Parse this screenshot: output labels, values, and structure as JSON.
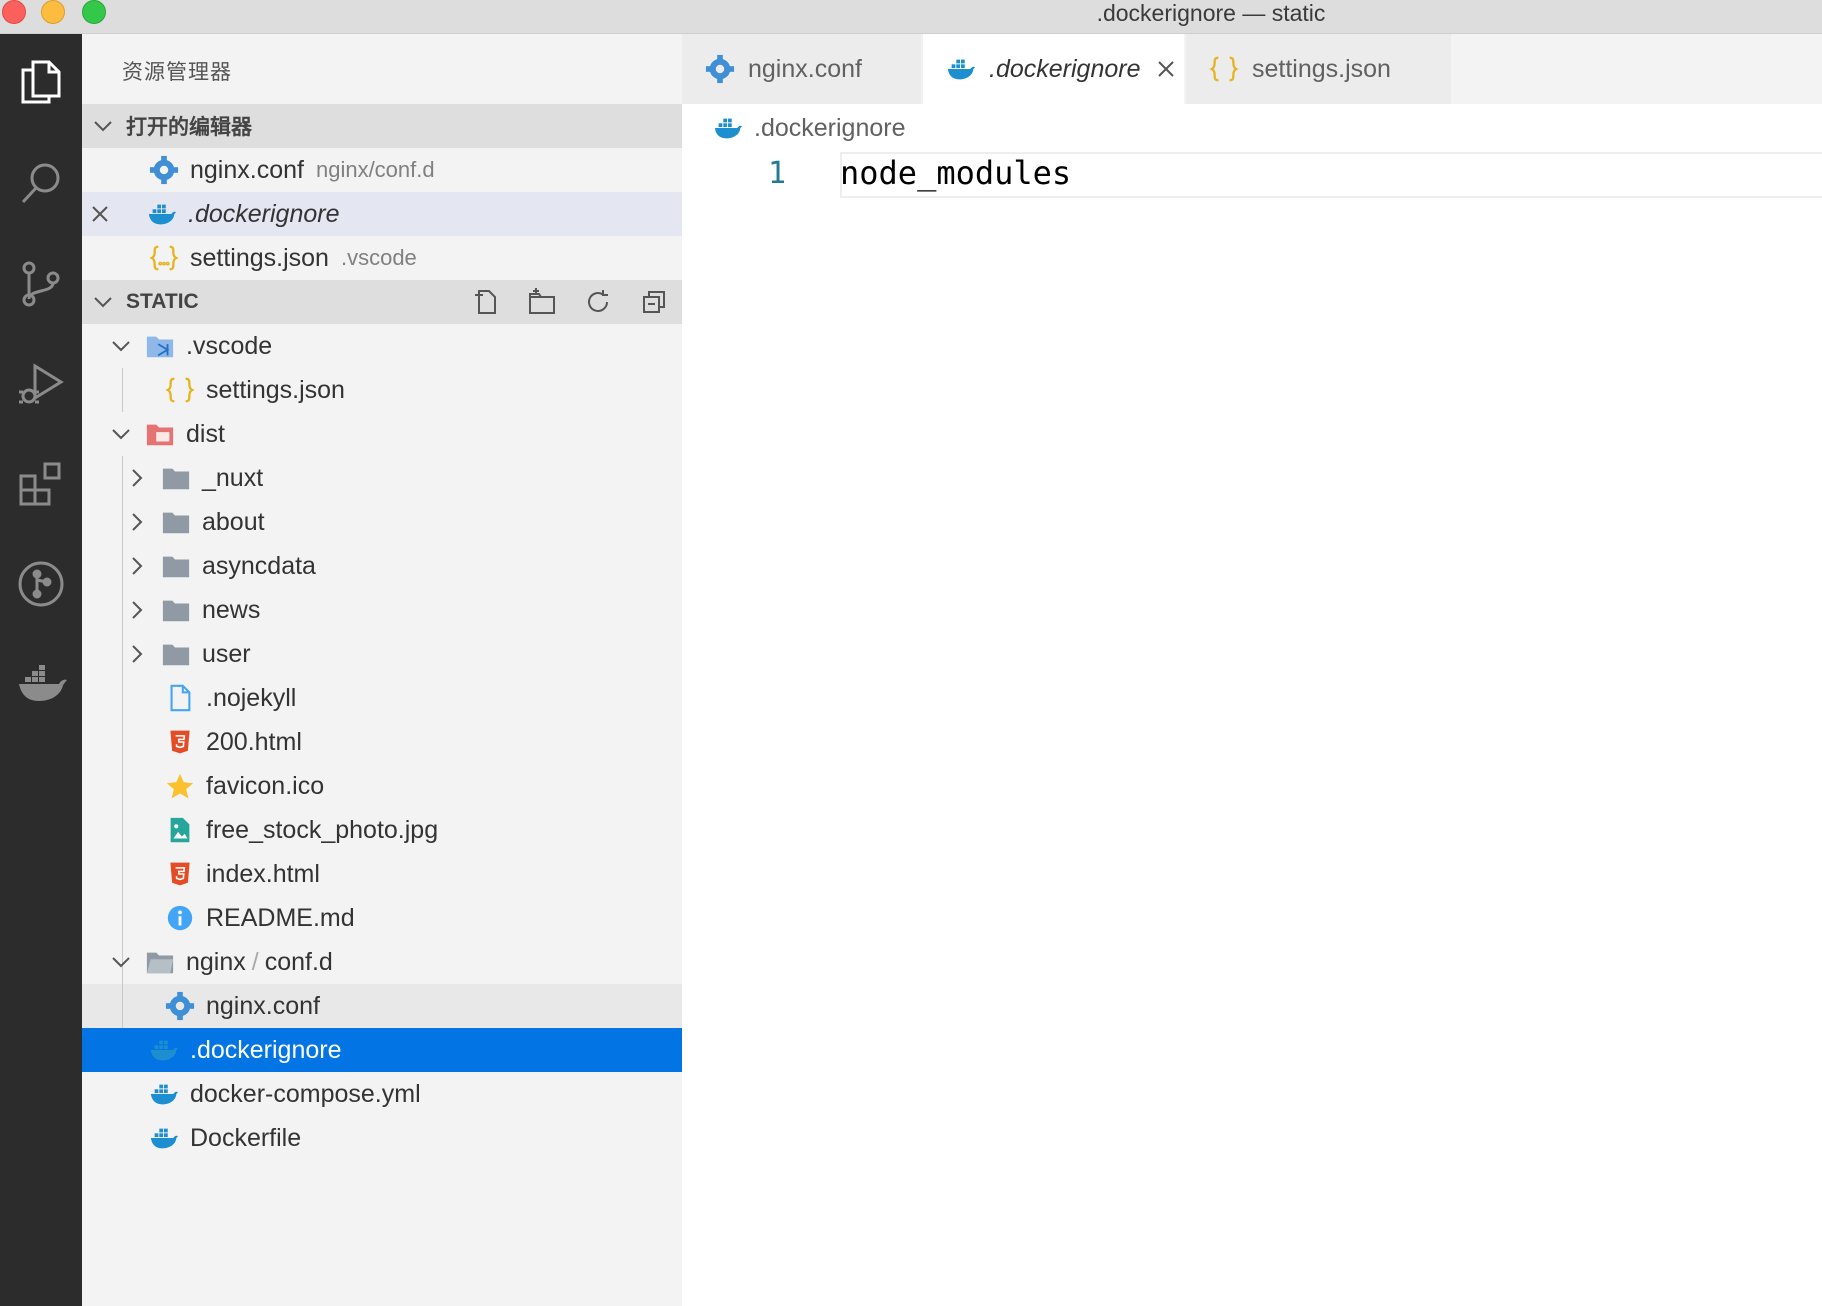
{
  "window": {
    "title": ".dockerignore — static"
  },
  "activity_bar": {
    "items": [
      {
        "name": "explorer-icon"
      },
      {
        "name": "search-icon"
      },
      {
        "name": "source-control-icon"
      },
      {
        "name": "run-debug-icon"
      },
      {
        "name": "extensions-icon"
      },
      {
        "name": "gitlens-icon"
      },
      {
        "name": "docker-icon"
      }
    ]
  },
  "sidebar": {
    "title": "资源管理器",
    "open_editors": {
      "label": "打开的编辑器",
      "items": [
        {
          "label": "nginx.conf",
          "sub": "nginx/conf.d",
          "icon": "gear-icon"
        },
        {
          "label": ".dockerignore",
          "sub": "",
          "icon": "docker-icon"
        },
        {
          "label": "settings.json",
          "sub": ".vscode",
          "icon": "json-icon"
        }
      ]
    },
    "workspace": {
      "label": "STATIC",
      "tree": [
        {
          "label": ".vscode",
          "icon": "vscode-folder-icon"
        },
        {
          "label": "settings.json",
          "icon": "json-icon"
        },
        {
          "label": "dist",
          "icon": "dist-folder-icon"
        },
        {
          "label": "_nuxt",
          "icon": "folder-icon"
        },
        {
          "label": "about",
          "icon": "folder-icon"
        },
        {
          "label": "asyncdata",
          "icon": "folder-icon"
        },
        {
          "label": "news",
          "icon": "folder-icon"
        },
        {
          "label": "user",
          "icon": "folder-icon"
        },
        {
          "label": ".nojekyll",
          "icon": "file-icon"
        },
        {
          "label": "200.html",
          "icon": "html5-icon"
        },
        {
          "label": "favicon.ico",
          "icon": "star-icon"
        },
        {
          "label": "free_stock_photo.jpg",
          "icon": "image-icon"
        },
        {
          "label": "index.html",
          "icon": "html5-icon"
        },
        {
          "label": "README.md",
          "icon": "info-icon"
        },
        {
          "label": "nginx",
          "sep": "/",
          "label2": "conf.d",
          "icon": "folder-open-icon"
        },
        {
          "label": "nginx.conf",
          "icon": "gear-icon"
        },
        {
          "label": ".dockerignore",
          "icon": "docker-icon"
        },
        {
          "label": "docker-compose.yml",
          "icon": "docker-icon"
        },
        {
          "label": "Dockerfile",
          "icon": "docker-icon"
        }
      ]
    }
  },
  "editor": {
    "tabs": [
      {
        "label": "nginx.conf",
        "icon": "gear-icon"
      },
      {
        "label": ".dockerignore",
        "icon": "docker-icon",
        "active": true
      },
      {
        "label": "settings.json",
        "icon": "json-icon"
      }
    ],
    "breadcrumb": ".dockerignore",
    "lines": [
      {
        "number": "1",
        "text": "node_modules"
      }
    ]
  },
  "colors": {
    "accent": "#0374e3",
    "activity_bar": "#2c2c2c",
    "docker_blue": "#1d8fd1",
    "json_yellow": "#e6b422",
    "html_red": "#e34c26"
  }
}
